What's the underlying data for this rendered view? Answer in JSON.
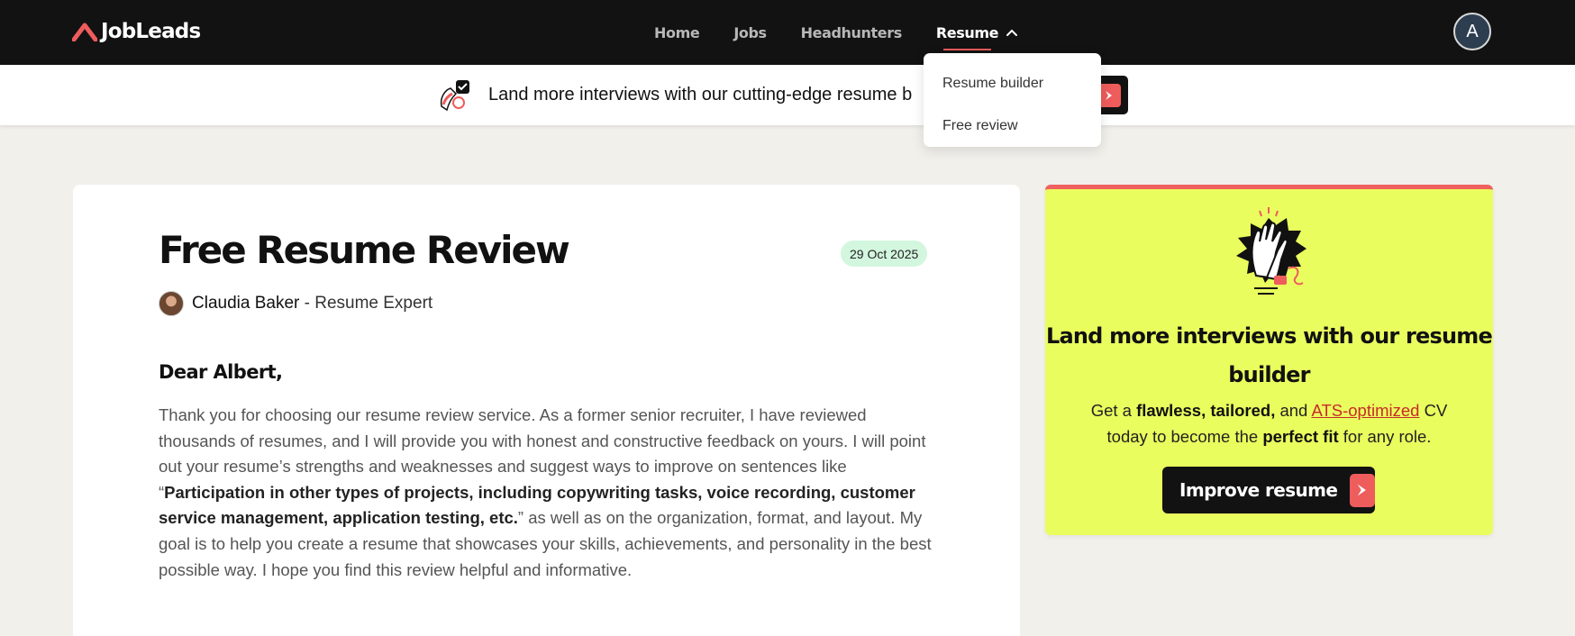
{
  "nav": {
    "logo_text": "JobLeads",
    "links": [
      "Home",
      "Jobs",
      "Headhunters"
    ],
    "active_link": "Resume",
    "avatar_letter": "A"
  },
  "banner": {
    "text": "Land more interviews with our cutting-edge resume b"
  },
  "dropdown": {
    "items": [
      "Resume builder",
      "Free review"
    ]
  },
  "article": {
    "title": "Free Resume Review",
    "date": "29 Oct 2025",
    "author_name": "Claudia Baker",
    "author_role": " - Resume Expert",
    "greeting": "Dear Albert,",
    "body_before": "Thank you for choosing our resume review service. As a former senior recruiter, I have reviewed thousands of resumes, and I will provide you with honest and constructive feedback on yours. I will point out your resume’s strengths and weaknesses and suggest ways to improve on sentences like “",
    "body_quote": "Participation in other types of projects, including copywriting tasks, voice recording, customer service management, application testing, etc.",
    "body_after": "” as well as on the organization, format, and layout. My goal is to help you create a resume that showcases your skills, achievements, and personality in the best possible way. I hope you find this review helpful and informative."
  },
  "promo": {
    "title": "Land more interviews with our resume builder",
    "desc_1": "Get a ",
    "desc_bold_1": "flawless, tailored,",
    "desc_2": " and ",
    "desc_link": "ATS-optimized",
    "desc_3": " CV today to become the ",
    "desc_bold_2": "perfect fit",
    "desc_4": " for any role.",
    "button_label": "Improve resume"
  },
  "colors": {
    "accent_red": "#ee5c5c",
    "promo_bg": "#eafd5e",
    "nav_bg": "#121212",
    "date_badge_bg": "#d3f6de"
  }
}
